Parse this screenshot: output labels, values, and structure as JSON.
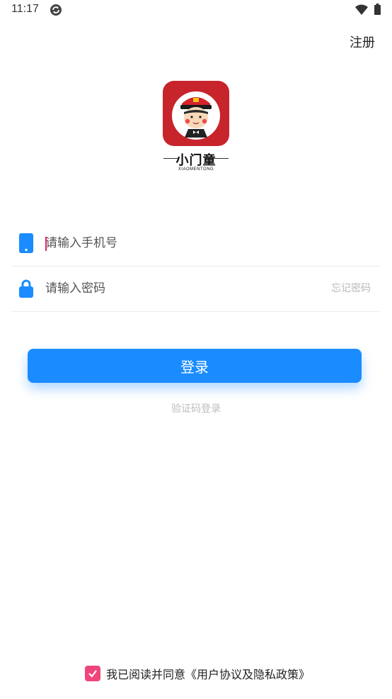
{
  "status_bar": {
    "time": "11:17",
    "icons": [
      "sync-icon",
      "wifi-icon",
      "battery-icon"
    ]
  },
  "header": {
    "register_label": "注册"
  },
  "brand": {
    "name": "小门童",
    "subtitle": "XIAOMENTONG",
    "logo_color": "#c8242b"
  },
  "form": {
    "phone_placeholder": "请输入手机号",
    "phone_value": "",
    "password_placeholder": "请输入密码",
    "password_value": "",
    "forgot_label": "忘记密码",
    "icon_color": "#1a8cff",
    "login_label": "登录",
    "code_login_label": "验证码登录"
  },
  "agreement": {
    "checked": true,
    "text": "我已阅读并同意《用户协议及隐私政策》",
    "check_color": "#f0457a"
  }
}
